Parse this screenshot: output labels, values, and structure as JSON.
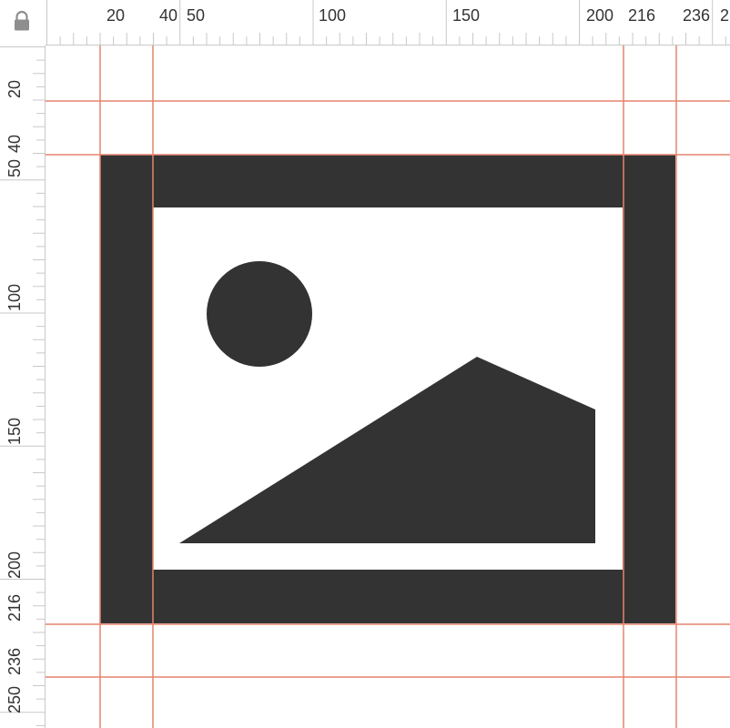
{
  "ruler": {
    "lock_icon": "lock-icon",
    "top_labels": [
      {
        "value": "20",
        "key": "t20"
      },
      {
        "value": "40",
        "key": "t40"
      },
      {
        "value": "50",
        "key": "t50"
      },
      {
        "value": "100",
        "key": "t100"
      },
      {
        "value": "150",
        "key": "t150"
      },
      {
        "value": "200",
        "key": "t200"
      },
      {
        "value": "216",
        "key": "t216"
      },
      {
        "value": "236",
        "key": "t236"
      },
      {
        "value": "2",
        "key": "t250"
      }
    ],
    "left_labels": [
      {
        "value": "20",
        "key": "l20"
      },
      {
        "value": "40",
        "key": "l40"
      },
      {
        "value": "50",
        "key": "l50"
      },
      {
        "value": "100",
        "key": "l100"
      },
      {
        "value": "150",
        "key": "l150"
      },
      {
        "value": "200",
        "key": "l200"
      },
      {
        "value": "216",
        "key": "l216"
      },
      {
        "value": "236",
        "key": "l236"
      },
      {
        "value": "250",
        "key": "l250"
      }
    ]
  },
  "colors": {
    "icon": "#333333",
    "guide": "#e5836f",
    "ruler_line": "#c8c8c8",
    "ruler_bg": "#ffffff",
    "lock": "#8e8e8e"
  },
  "artwork": {
    "icon_name": "image-icon",
    "parts": [
      "frame",
      "sun",
      "mountain"
    ]
  }
}
